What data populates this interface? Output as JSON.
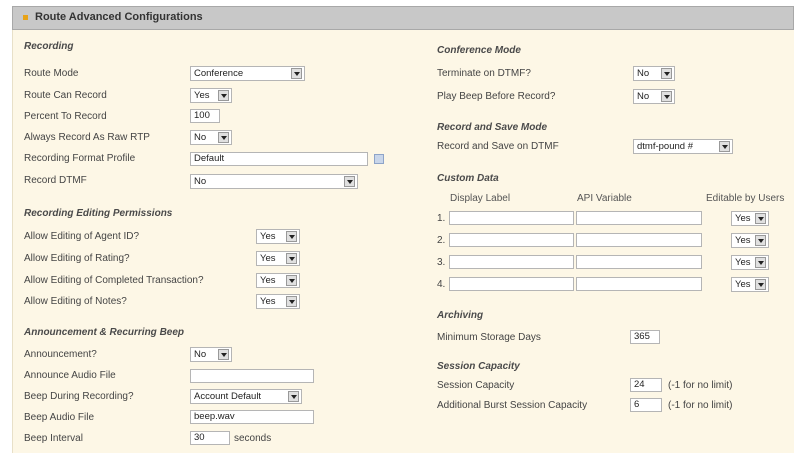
{
  "header": {
    "title": "Route Advanced Configurations"
  },
  "recording": {
    "title": "Recording",
    "route_mode": {
      "label": "Route Mode",
      "value": "Conference"
    },
    "route_can_record": {
      "label": "Route Can Record",
      "value": "Yes"
    },
    "percent_to_record": {
      "label": "Percent To Record",
      "value": "100"
    },
    "always_raw_rtp": {
      "label": "Always Record As Raw RTP",
      "value": "No"
    },
    "format_profile": {
      "label": "Recording Format Profile",
      "value": "Default"
    },
    "record_dtmf": {
      "label": "Record DTMF",
      "value": "No"
    }
  },
  "permissions": {
    "title": "Recording Editing Permissions",
    "agent_id": {
      "label": "Allow Editing of Agent ID?",
      "value": "Yes"
    },
    "rating": {
      "label": "Allow Editing of Rating?",
      "value": "Yes"
    },
    "completed": {
      "label": "Allow Editing of Completed Transaction?",
      "value": "Yes"
    },
    "notes": {
      "label": "Allow Editing of Notes?",
      "value": "Yes"
    }
  },
  "announcement": {
    "title": "Announcement & Recurring Beep",
    "announcement": {
      "label": "Announcement?",
      "value": "No"
    },
    "audio_file": {
      "label": "Announce Audio File",
      "value": ""
    },
    "beep_during": {
      "label": "Beep During Recording?",
      "value": "Account Default"
    },
    "beep_file": {
      "label": "Beep Audio File",
      "value": "beep.wav"
    },
    "beep_interval": {
      "label": "Beep Interval",
      "value": "30",
      "unit": "seconds"
    }
  },
  "conference": {
    "title": "Conference Mode",
    "terminate": {
      "label": "Terminate on DTMF?",
      "value": "No"
    },
    "play_beep": {
      "label": "Play Beep Before Record?",
      "value": "No"
    }
  },
  "record_save": {
    "title": "Record and Save Mode",
    "on_dtmf": {
      "label": "Record and Save on DTMF",
      "value": "dtmf-pound #"
    }
  },
  "custom_data": {
    "title": "Custom Data",
    "col_display": "Display Label",
    "col_api": "API Variable",
    "col_editable": "Editable by Users",
    "rows": [
      {
        "num": "1.",
        "display": "",
        "api": "",
        "editable": "Yes"
      },
      {
        "num": "2.",
        "display": "",
        "api": "",
        "editable": "Yes"
      },
      {
        "num": "3.",
        "display": "",
        "api": "",
        "editable": "Yes"
      },
      {
        "num": "4.",
        "display": "",
        "api": "",
        "editable": "Yes"
      }
    ]
  },
  "archiving": {
    "title": "Archiving",
    "min_days": {
      "label": "Minimum Storage Days",
      "value": "365"
    }
  },
  "session": {
    "title": "Session Capacity",
    "capacity": {
      "label": "Session Capacity",
      "value": "24",
      "hint": "(-1 for no limit)"
    },
    "burst": {
      "label": "Additional Burst Session Capacity",
      "value": "6",
      "hint": "(-1 for no limit)"
    }
  }
}
